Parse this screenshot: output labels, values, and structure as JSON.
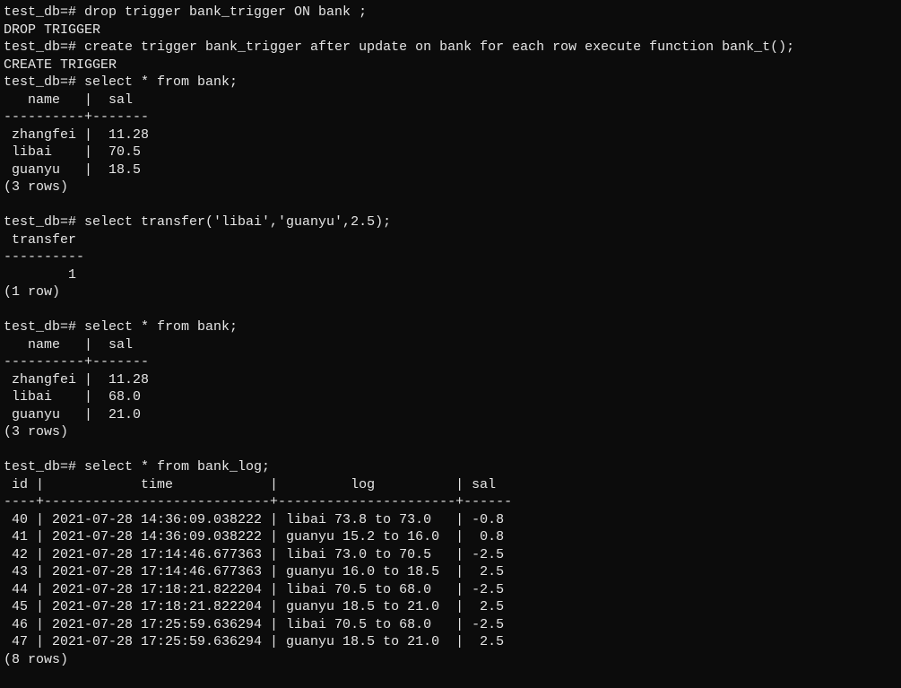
{
  "prompt": "test_db=#",
  "commands": {
    "drop_trigger": "drop trigger bank_trigger ON bank ;",
    "drop_trigger_result": "DROP TRIGGER",
    "create_trigger": "create trigger bank_trigger after update on bank for each row execute function bank_t();",
    "create_trigger_result": "CREATE TRIGGER",
    "select_bank": "select * from bank;",
    "select_transfer": "select transfer('libai','guanyu',2.5);",
    "select_bank_log": "select * from bank_log;"
  },
  "bank_table_headers": {
    "name": "name",
    "sal": "sal"
  },
  "bank_table_1": {
    "rows": [
      {
        "name": "zhangfei",
        "sal": "11.28"
      },
      {
        "name": "libai",
        "sal": "70.5"
      },
      {
        "name": "guanyu",
        "sal": "18.5"
      }
    ],
    "rowcount": "(3 rows)"
  },
  "transfer_result": {
    "header": "transfer",
    "value": "1",
    "rowcount": "(1 row)"
  },
  "bank_table_2": {
    "rows": [
      {
        "name": "zhangfei",
        "sal": "11.28"
      },
      {
        "name": "libai",
        "sal": "68.0"
      },
      {
        "name": "guanyu",
        "sal": "21.0"
      }
    ],
    "rowcount": "(3 rows)"
  },
  "bank_log_headers": {
    "id": "id",
    "time": "time",
    "log": "log",
    "sal": "sal"
  },
  "bank_log": {
    "rows": [
      {
        "id": "40",
        "time": "2021-07-28 14:36:09.038222",
        "log": "libai 73.8 to 73.0",
        "sal": "-0.8"
      },
      {
        "id": "41",
        "time": "2021-07-28 14:36:09.038222",
        "log": "guanyu 15.2 to 16.0",
        "sal": " 0.8"
      },
      {
        "id": "42",
        "time": "2021-07-28 17:14:46.677363",
        "log": "libai 73.0 to 70.5",
        "sal": "-2.5"
      },
      {
        "id": "43",
        "time": "2021-07-28 17:14:46.677363",
        "log": "guanyu 16.0 to 18.5",
        "sal": " 2.5"
      },
      {
        "id": "44",
        "time": "2021-07-28 17:18:21.822204",
        "log": "libai 70.5 to 68.0",
        "sal": "-2.5"
      },
      {
        "id": "45",
        "time": "2021-07-28 17:18:21.822204",
        "log": "guanyu 18.5 to 21.0",
        "sal": " 2.5"
      },
      {
        "id": "46",
        "time": "2021-07-28 17:25:59.636294",
        "log": "libai 70.5 to 68.0",
        "sal": "-2.5"
      },
      {
        "id": "47",
        "time": "2021-07-28 17:25:59.636294",
        "log": "guanyu 18.5 to 21.0",
        "sal": " 2.5"
      }
    ],
    "rowcount": "(8 rows)"
  }
}
